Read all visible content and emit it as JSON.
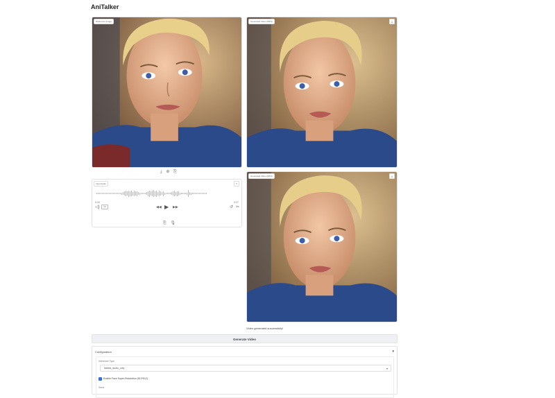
{
  "app": {
    "title": "AniTalker"
  },
  "source_image": {
    "label": "Reference Image",
    "toolbar": [
      "⤓",
      "⊕",
      "⎘"
    ]
  },
  "generated_top": {
    "label": "Generated Video (MP4)",
    "button": "⤓"
  },
  "generated_bottom": {
    "label": "Generated Video (MP4)",
    "button": "⤓"
  },
  "audio": {
    "label": "Input Audio",
    "time_start": "0:00",
    "time_end": "0:07",
    "speed": "1x",
    "controls": {
      "rewind": "◀◀",
      "play": "▶",
      "forward": "▶▶",
      "undo": "↺",
      "trim": "✂"
    },
    "toolbar": [
      "⎘",
      "🎙"
    ]
  },
  "status_text": "Video generated successfully!",
  "generate_button": "Generate Video",
  "configuration": {
    "title": "Configuration",
    "inference_type_label": "Inference Type",
    "inference_type_value": "fastest_audio_only",
    "checkbox_label": "Enable Face Super-Resolution (512*512)",
    "seed_label": "Seed"
  },
  "colors": {
    "accent": "#3b6fd6",
    "button_bg": "#eef0f3"
  }
}
